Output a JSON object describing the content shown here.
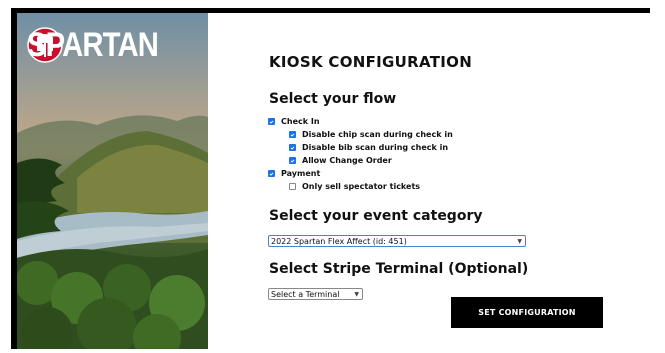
{
  "brand": {
    "name": "SPARTAN"
  },
  "page": {
    "title": "KIOSK CONFIGURATION"
  },
  "flow": {
    "title": "Select your flow",
    "options": [
      {
        "label": "Check In",
        "checked": true
      },
      {
        "label": "Disable chip scan during check in",
        "checked": true
      },
      {
        "label": "Disable bib scan during check in",
        "checked": true
      },
      {
        "label": "Allow Change Order",
        "checked": true
      },
      {
        "label": "Payment",
        "checked": true
      },
      {
        "label": "Only sell spectator tickets",
        "checked": false
      }
    ]
  },
  "event_category": {
    "title": "Select your event category",
    "selected": "2022 Spartan Flex Affect (id: 451)"
  },
  "terminal": {
    "title": "Select Stripe Terminal (Optional)",
    "selected": "Select a Terminal"
  },
  "actions": {
    "submit_label": "SET CONFIGURATION"
  },
  "colors": {
    "accent": "#1a73e8",
    "brand_red": "#c8102e",
    "button": "#000000"
  }
}
